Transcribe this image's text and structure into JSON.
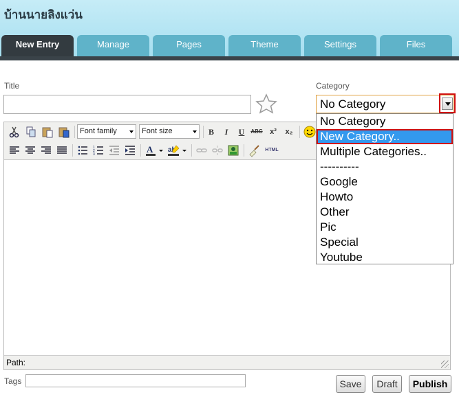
{
  "site": {
    "title": "บ้านนายลิงแว่น"
  },
  "tabs": [
    {
      "label": "New Entry",
      "active": true
    },
    {
      "label": "Manage"
    },
    {
      "label": "Pages"
    },
    {
      "label": "Theme"
    },
    {
      "label": "Settings"
    },
    {
      "label": "Files"
    }
  ],
  "form": {
    "title_label": "Title",
    "title_value": "",
    "category_label": "Category",
    "category_value": "No Category",
    "category_options": [
      "No Category",
      "New Category..",
      "Multiple Categories..",
      "----------",
      "Google",
      "Howto",
      "Other",
      "Pic",
      "Special",
      "Youtube"
    ],
    "category_highlighted": "New Category..",
    "tags_label": "Tags",
    "tags_value": ""
  },
  "editor": {
    "font_family": "Font family",
    "font_size": "Font size",
    "bold": "B",
    "italic": "I",
    "underline": "U",
    "strike": "ABC",
    "superscript": "x²",
    "subscript": "x₂",
    "html": "HTML",
    "path_label": "Path:",
    "toolbar_icons": [
      "cut-icon",
      "copy-icon",
      "paste-icon",
      "paste-word-icon",
      "align-left-icon",
      "align-center-icon",
      "align-right-icon",
      "align-justify-icon",
      "bullet-list-icon",
      "numbered-list-icon",
      "outdent-icon",
      "indent-icon",
      "text-color-icon",
      "highlight-icon",
      "link-icon",
      "unlink-icon",
      "image-icon",
      "cleanup-icon",
      "emoticon-icon"
    ]
  },
  "actions": {
    "save": "Save",
    "draft": "Draft",
    "publish": "Publish"
  },
  "colors": {
    "header_bg": "#b4e4f3",
    "tab": "#5fb3c9",
    "tab_active": "#333b40",
    "highlight": "#3399ee",
    "annotation": "#d01010"
  }
}
